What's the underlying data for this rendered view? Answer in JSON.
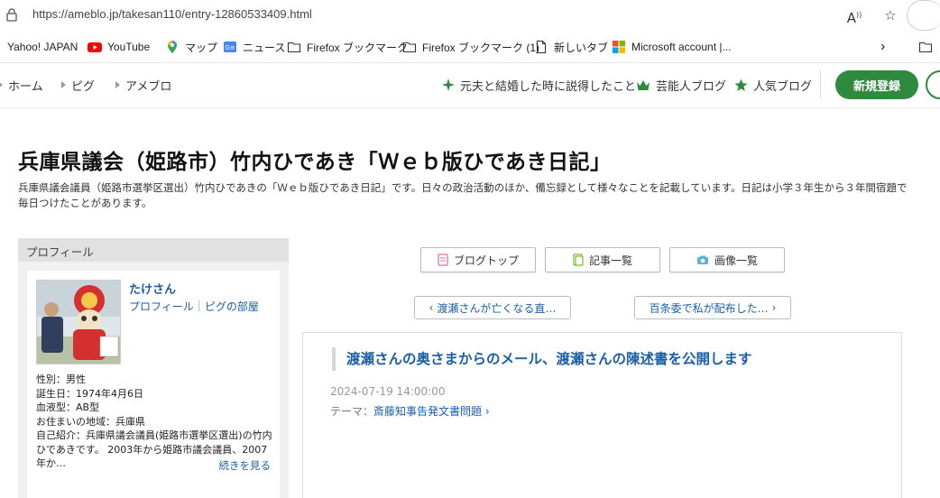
{
  "browser": {
    "url": "https://ameblo.jp/takesan110/entry-12860533409.html",
    "bookmarks": [
      {
        "label": "Yahoo! JAPAN",
        "icon": "yahoo-icon"
      },
      {
        "label": "YouTube",
        "icon": "youtube-icon",
        "color": "#ff0000"
      },
      {
        "label": "マップ",
        "icon": "maps-pin-icon"
      },
      {
        "label": "ニュース",
        "icon": "news-icon"
      },
      {
        "label": "Firefox ブックマーク",
        "icon": "folder-icon"
      },
      {
        "label": "Firefox ブックマーク (1)",
        "icon": "folder-icon"
      },
      {
        "label": "新しいタブ",
        "icon": "page-icon"
      },
      {
        "label": "Microsoft account |...",
        "icon": "microsoft-icon"
      }
    ]
  },
  "topnav": {
    "crumbs": [
      "ホーム",
      "ピグ",
      "アメブロ"
    ],
    "links": [
      {
        "label": "元夫と結婚した時に説得したこと",
        "icon": "sparkle-icon"
      },
      {
        "label": "芸能人ブログ",
        "icon": "crown-icon"
      },
      {
        "label": "人気ブログ",
        "icon": "star-icon"
      }
    ],
    "signup_label": "新規登録",
    "accent_color": "#2e8b3d"
  },
  "blog": {
    "title": "兵庫県議会（姫路市）竹内ひであき「Ｗｅｂ版ひであき日記」",
    "description": "兵庫県議会議員（姫路市選挙区選出）竹内ひであきの「Ｗｅｂ版ひであき日記」です。日々の政治活動のほか、備忘録として様々なことを記載しています。日記は小学３年生から３年間宿題で毎日つけたことがあります。"
  },
  "sidebar": {
    "heading": "プロフィール",
    "name": "たけさん",
    "links": [
      "プロフィール",
      "ピグの部屋"
    ],
    "info": [
      "性別：男性",
      "誕生日：1974年4月6日",
      "血液型：AB型",
      "お住まいの地域：兵庫県",
      "自己紹介：兵庫県議会議員(姫路市選挙区選出)の竹内ひであきです。 2003年から姫路市議会議員、2007年か…"
    ],
    "more_label": "続きを見る"
  },
  "main": {
    "tabs": [
      {
        "label": "ブログトップ",
        "icon": "blog-top-icon"
      },
      {
        "label": "記事一覧",
        "icon": "article-list-icon"
      },
      {
        "label": "画像一覧",
        "icon": "camera-icon"
      }
    ],
    "prev_label": "渡瀬さんが亡くなる直…",
    "next_label": "百条委で私が配布した…",
    "article": {
      "title": "渡瀬さんの奥さまからのメール、渡瀬さんの陳述書を公開します",
      "date": "2024-07-19 14:00:00",
      "theme_prefix": "テーマ：",
      "theme": "斎藤知事告発文書問題"
    }
  }
}
